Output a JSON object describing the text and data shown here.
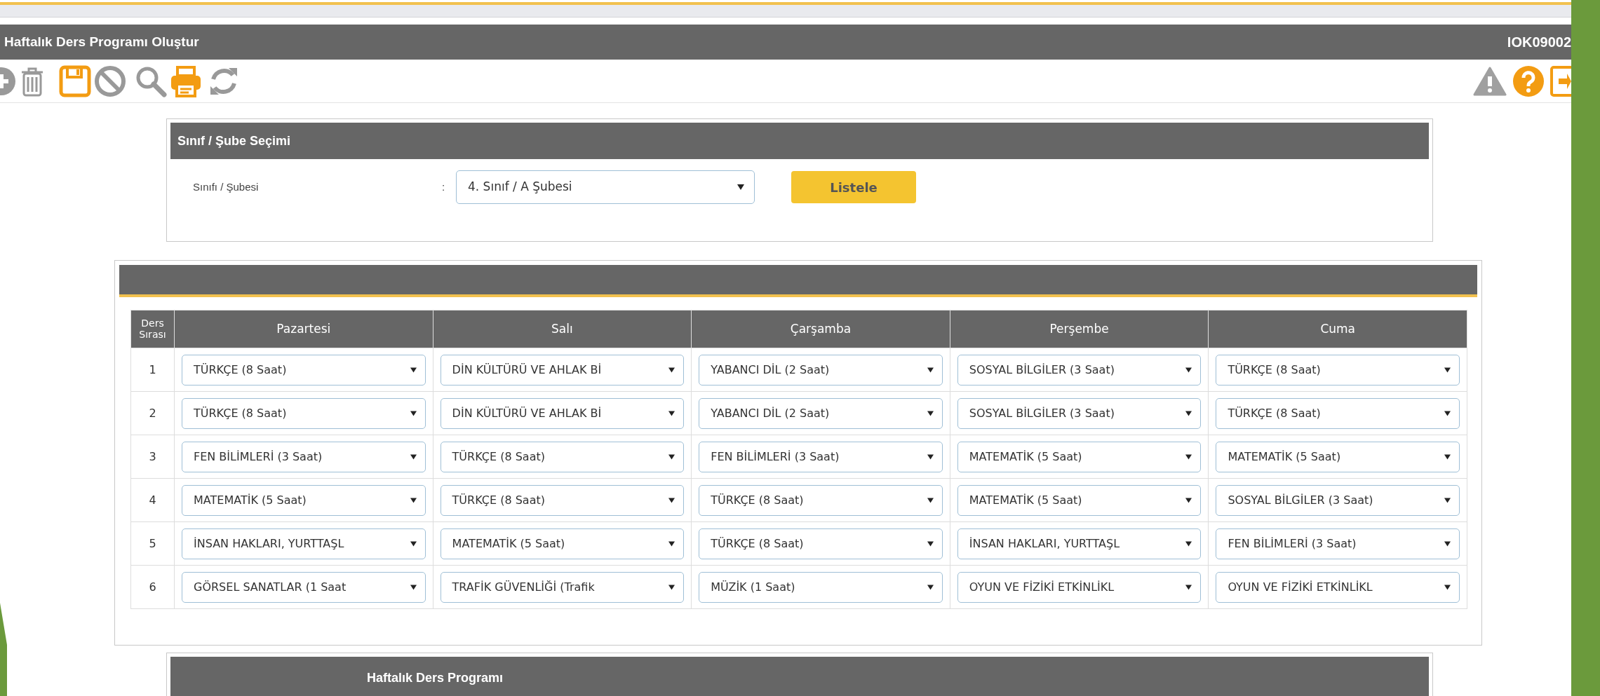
{
  "window": {
    "title": "Haftalık Ders Programı Oluştur",
    "code": "IOK09002"
  },
  "selection_panel": {
    "title": "Sınıf / Şube Seçimi",
    "label": "Sınıfı / Şubesi",
    "separator": ":",
    "value": "4. Sınıf / A Şubesi",
    "button": "Listele"
  },
  "table": {
    "columns": [
      "Ders Sırası",
      "Pazartesi",
      "Salı",
      "Çarşamba",
      "Perşembe",
      "Cuma"
    ],
    "rows": [
      {
        "cells": [
          "1",
          "TÜRKÇE (8 Saat)",
          "DİN KÜLTÜRÜ VE AHLAK Bİ",
          "YABANCI DİL (2 Saat)",
          "SOSYAL BİLGİLER (3 Saat)",
          "TÜRKÇE (8 Saat)"
        ]
      },
      {
        "cells": [
          "2",
          "TÜRKÇE (8 Saat)",
          "DİN KÜLTÜRÜ VE AHLAK Bİ",
          "YABANCI DİL (2 Saat)",
          "SOSYAL BİLGİLER (3 Saat)",
          "TÜRKÇE (8 Saat)"
        ]
      },
      {
        "cells": [
          "3",
          "FEN BİLİMLERİ (3 Saat)",
          "TÜRKÇE (8 Saat)",
          "FEN BİLİMLERİ (3 Saat)",
          "MATEMATİK (5 Saat)",
          "MATEMATİK (5 Saat)"
        ]
      },
      {
        "cells": [
          "4",
          "MATEMATİK (5 Saat)",
          "TÜRKÇE (8 Saat)",
          "TÜRKÇE (8 Saat)",
          "MATEMATİK (5 Saat)",
          "SOSYAL BİLGİLER (3 Saat)"
        ]
      },
      {
        "cells": [
          "5",
          "İNSAN HAKLARI, YURTTAŞL",
          "MATEMATİK (5 Saat)",
          "TÜRKÇE (8 Saat)",
          "İNSAN HAKLARI, YURTTAŞL",
          "FEN BİLİMLERİ (3 Saat)"
        ]
      },
      {
        "cells": [
          "6",
          "GÖRSEL SANATLAR (1 Saat",
          "TRAFİK GÜVENLİĞİ (Trafik",
          "MÜZİK (1 Saat)",
          "OYUN VE FİZİKİ ETKİNLİKL",
          "OYUN VE FİZİKİ ETKİNLİKL"
        ]
      }
    ]
  },
  "bottom_panel": {
    "title": "Haftalık Ders Programı"
  }
}
